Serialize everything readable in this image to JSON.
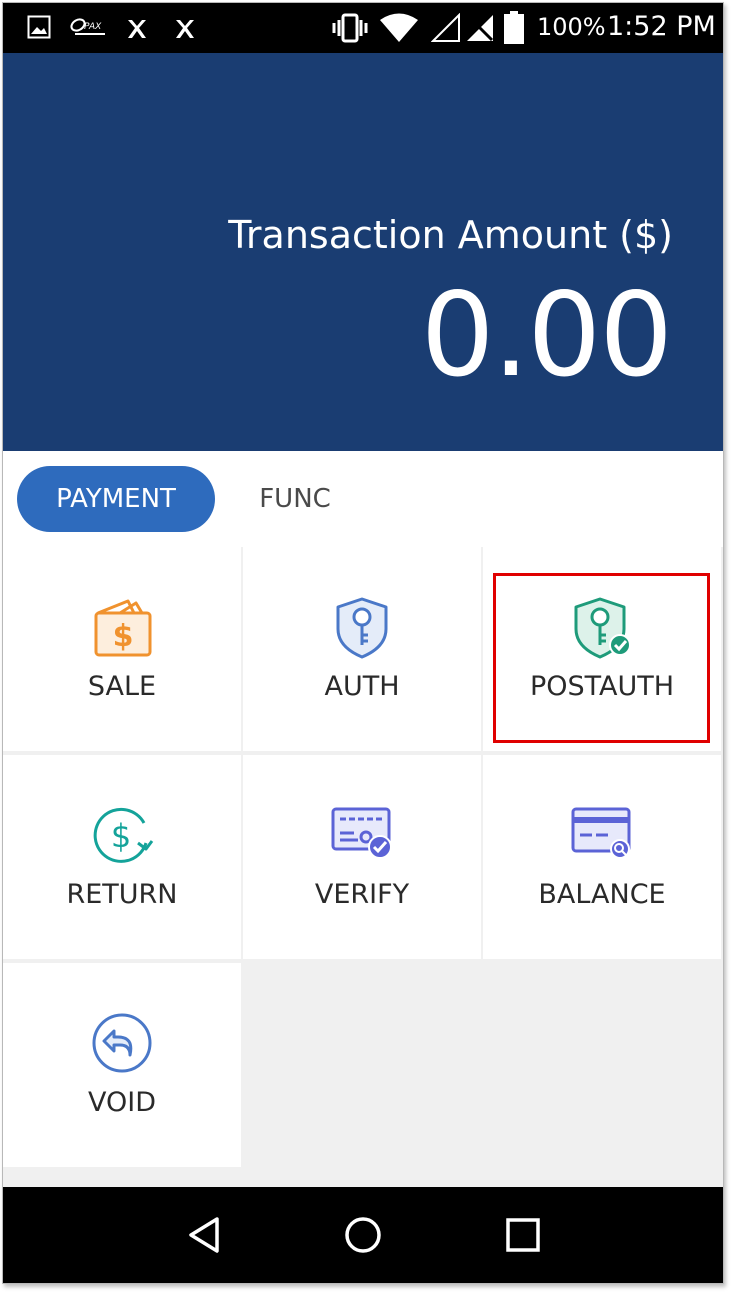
{
  "status_bar": {
    "battery": "100%",
    "time": "1:52 PM",
    "icons": [
      "image-icon",
      "pax-logo-icon",
      "app-x-icon",
      "app-x-icon",
      "vibrate-icon",
      "wifi-icon",
      "signal-icon",
      "no-sim-icon",
      "battery-icon"
    ]
  },
  "header": {
    "label": "Transaction Amount ($)",
    "amount": "0.00"
  },
  "tabs": [
    {
      "label": "PAYMENT",
      "active": true
    },
    {
      "label": "FUNC",
      "active": false
    }
  ],
  "tiles": [
    {
      "label": "SALE",
      "icon": "wallet-dollar-icon"
    },
    {
      "label": "AUTH",
      "icon": "shield-key-icon"
    },
    {
      "label": "POSTAUTH",
      "icon": "shield-key-check-icon"
    },
    {
      "label": "RETURN",
      "icon": "dollar-refresh-icon"
    },
    {
      "label": "VERIFY",
      "icon": "card-check-icon"
    },
    {
      "label": "BALANCE",
      "icon": "card-search-icon"
    },
    {
      "label": "VOID",
      "icon": "undo-circle-icon"
    }
  ],
  "nav": [
    "back-icon",
    "home-icon",
    "recents-icon"
  ],
  "colors": {
    "header_bg": "#1a3d72",
    "tab_active": "#2e6bbd",
    "sale_orange": "#f0922e",
    "auth_blue": "#4a78c8",
    "postauth_green": "#1e9b7a",
    "return_teal": "#14a39a",
    "verify_indigo": "#5b63d6",
    "highlight_red": "#e00000"
  }
}
